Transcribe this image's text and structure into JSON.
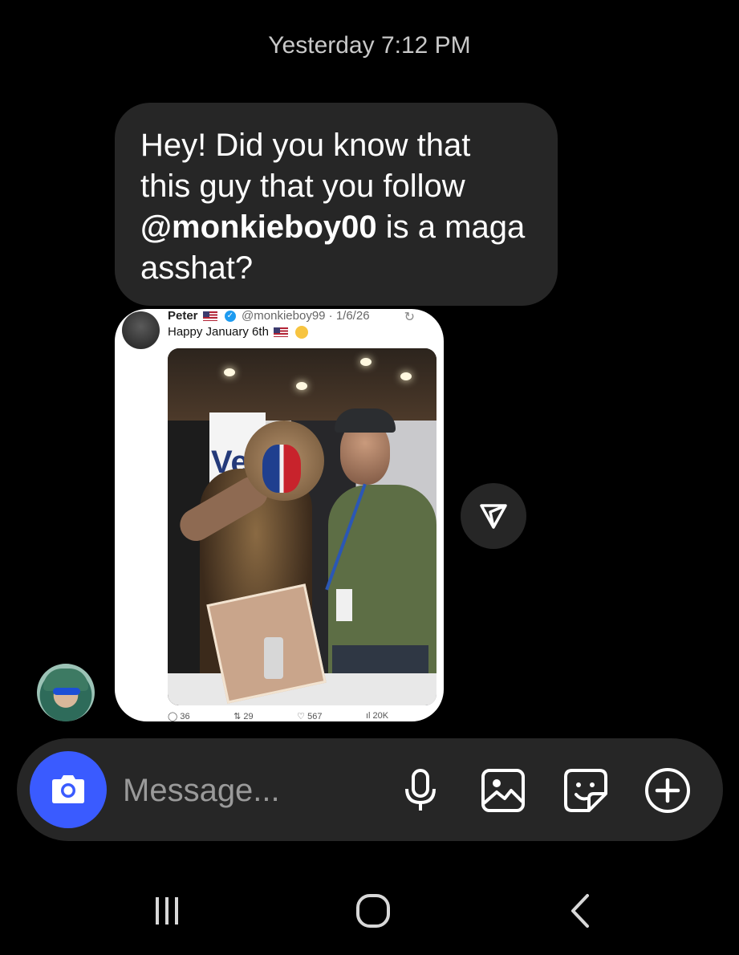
{
  "thread": {
    "timestamp": "Yesterday 7:12 PM",
    "message": {
      "line1": "Hey! Did you know that",
      "line2": "this guy that you follow",
      "threads_symbol": "@",
      "mention": "monkieboy00",
      "line3_rest": " is a maga",
      "line4": "asshat?"
    },
    "shared_post": {
      "author_name": "Peter",
      "handle_meta": "@monkieboy99 · 1/6/26",
      "text": "Happy January 6th",
      "stats": {
        "replies": "36",
        "reposts": "29",
        "likes": "567",
        "views": "20K"
      },
      "photo_sign_text": "Ve"
    },
    "icons": {
      "share": "send-icon",
      "sender_avatar": "avatar"
    }
  },
  "composer": {
    "placeholder": "Message...",
    "icons": [
      "camera-icon",
      "microphone-icon",
      "image-icon",
      "sticker-icon",
      "plus-circle-icon"
    ],
    "accent_color": "#3a5bff"
  },
  "system_nav": {
    "icons": [
      "recents-icon",
      "home-icon",
      "back-icon"
    ]
  }
}
